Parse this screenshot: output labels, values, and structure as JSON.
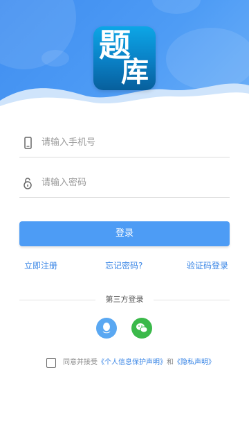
{
  "logo": {
    "char1": "题",
    "char2": "库"
  },
  "phone_field": {
    "placeholder": "请输入手机号",
    "icon": "phone-icon"
  },
  "password_field": {
    "placeholder": "请输入密码",
    "icon": "lock-icon"
  },
  "login_button": "登录",
  "links": {
    "register": "立即注册",
    "forgot": "忘记密码?",
    "code_login": "验证码登录"
  },
  "third_party": {
    "label": "第三方登录",
    "qq_icon": "qq-icon",
    "wechat_icon": "wechat-icon"
  },
  "agreement": {
    "prefix": "同意并接受",
    "privacy_policy": "《个人信息保护声明》",
    "and": "和",
    "privacy_statement": "《隐私声明》"
  },
  "colors": {
    "primary": "#4d9cf5",
    "link": "#3a86e6",
    "qq": "#5aa8f2",
    "wechat": "#3bb94a"
  }
}
